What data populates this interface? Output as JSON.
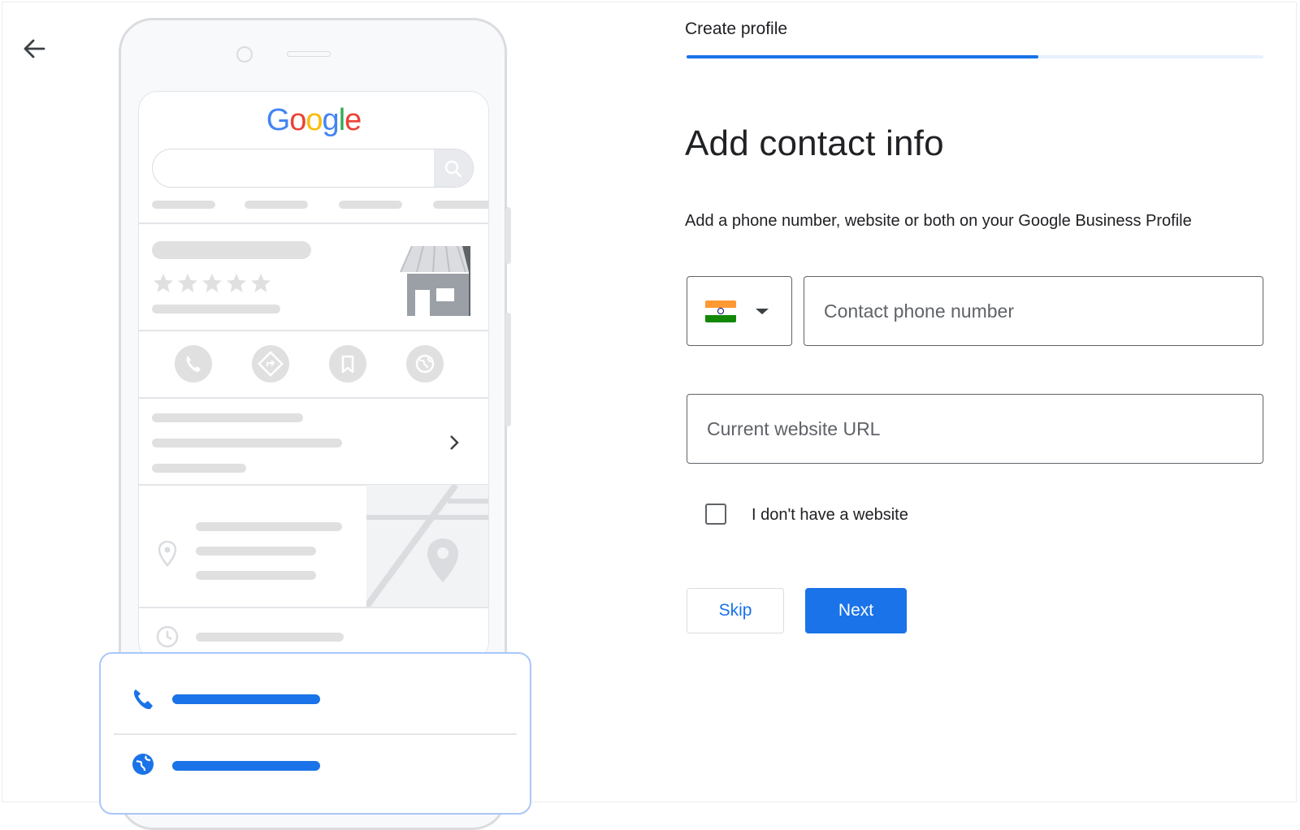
{
  "header": {
    "step_title": "Create profile",
    "progress_percent": 61
  },
  "main": {
    "title": "Add contact info",
    "subtitle": "Add a phone number, website or both on your Google Business Profile",
    "country": {
      "flag": "india-flag-icon",
      "flag_colors": [
        "#FF9933",
        "#FFFFFF",
        "#138808"
      ]
    },
    "phone_field": {
      "placeholder": "Contact phone number",
      "value": ""
    },
    "website_field": {
      "placeholder": "Current website URL",
      "value": ""
    },
    "no_website_checkbox": {
      "label": "I don't have a website",
      "checked": false
    },
    "buttons": {
      "skip": "Skip",
      "next": "Next"
    }
  },
  "illustration": {
    "logo_text": "Google",
    "logo_colors": [
      "#4285F4",
      "#EA4335",
      "#FBBC05",
      "#4285F4",
      "#34A853",
      "#EA4335"
    ],
    "rating_stars": 5,
    "action_icons": [
      "phone-icon",
      "directions-icon",
      "bookmark-icon",
      "globe-icon"
    ]
  },
  "colors": {
    "primary": "#1a73e8",
    "text": "#202124",
    "border": "#5f6368"
  }
}
